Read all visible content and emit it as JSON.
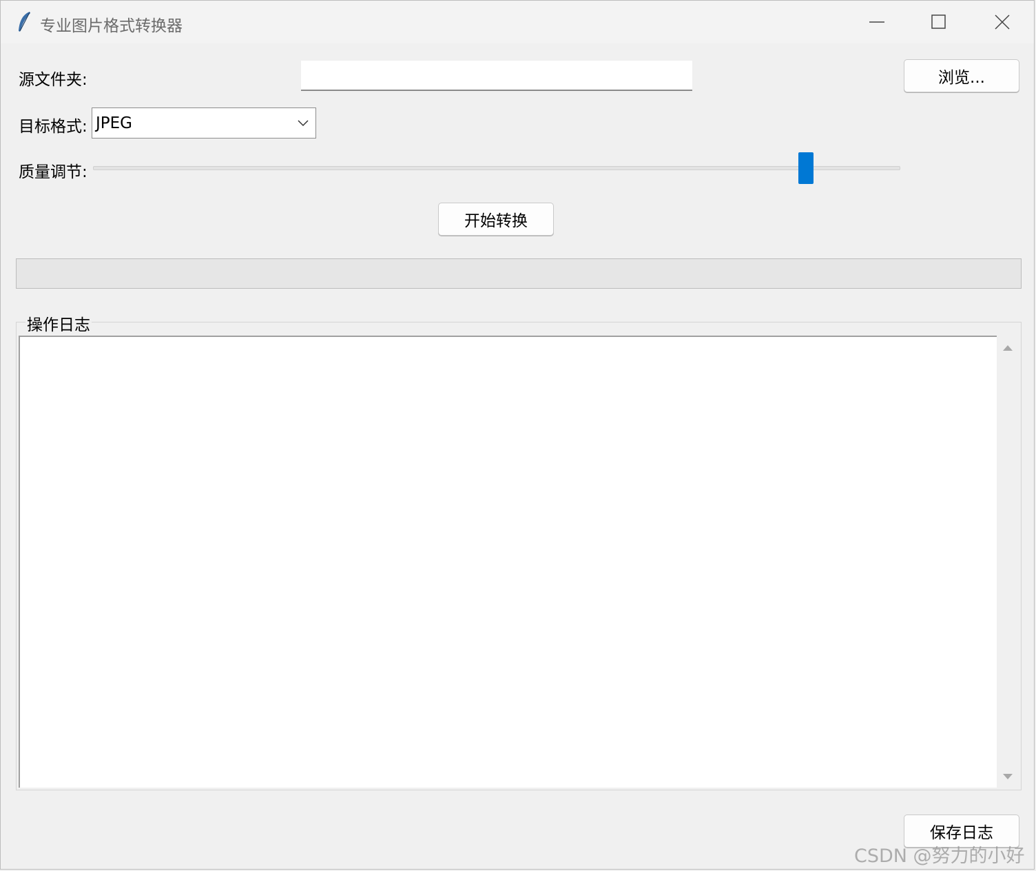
{
  "window": {
    "title": "专业图片格式转换器"
  },
  "form": {
    "source_label": "源文件夹:",
    "source_value": "",
    "browse_label": "浏览...",
    "format_label": "目标格式:",
    "format_selected": "JPEG",
    "quality_label": "质量调节:",
    "quality_value_fraction": 0.89,
    "start_label": "开始转换"
  },
  "progress": {
    "value_fraction": 0
  },
  "log": {
    "title": "操作日志",
    "content": ""
  },
  "footer": {
    "save_log_label": "保存日志"
  },
  "watermark": {
    "text": "CSDN @努力的小好"
  },
  "colors": {
    "accent": "#0078d4",
    "window_bg": "#f0f0f0"
  }
}
